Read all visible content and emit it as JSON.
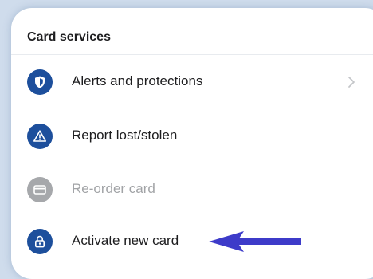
{
  "section": {
    "title": "Card services"
  },
  "items": [
    {
      "label": "Alerts and protections",
      "icon": "shield-icon",
      "enabled": true,
      "has_chevron": true
    },
    {
      "label": "Report lost/stolen",
      "icon": "warning-icon",
      "enabled": true,
      "has_chevron": false
    },
    {
      "label": "Re-order card",
      "icon": "card-icon",
      "enabled": false,
      "has_chevron": false
    },
    {
      "label": "Activate new card",
      "icon": "lock-icon",
      "enabled": true,
      "has_chevron": false
    }
  ],
  "colors": {
    "icon_active": "#1d4f9c",
    "icon_disabled": "#a6a8ab",
    "arrow": "#3d3bc9",
    "backdrop": "#cfdcec"
  }
}
